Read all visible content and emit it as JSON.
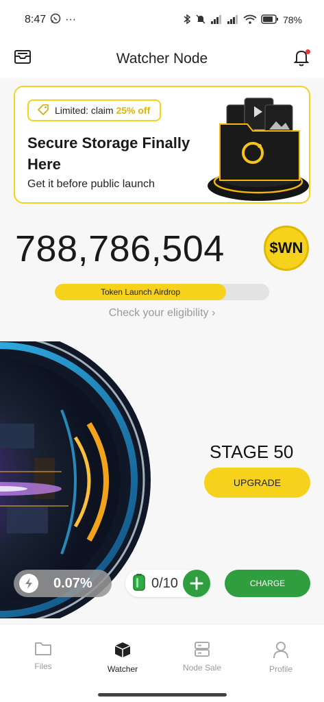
{
  "status_bar": {
    "time": "8:47",
    "dots": "···",
    "battery": "78%"
  },
  "header": {
    "title": "Watcher Node"
  },
  "promo": {
    "badge_prefix": "Limited: claim ",
    "badge_highlight": "25% off",
    "title": "Secure Storage Finally Here",
    "subtitle": "Get it before public launch"
  },
  "balance": {
    "amount": "788,786,504",
    "token": "$WN"
  },
  "airdrop": {
    "label": "Token Launch Airdrop",
    "progress": 0.8,
    "eligibility": "Check your eligibility ›"
  },
  "node": {
    "stage": "STAGE 50",
    "upgrade_label": "UPGRADE"
  },
  "stats": {
    "percentage": "0.07%",
    "battery_count": "0/10",
    "charge_label": "CHARGE"
  },
  "tabs": [
    {
      "label": "Files",
      "icon": "folder-icon"
    },
    {
      "label": "Watcher",
      "icon": "cube-icon"
    },
    {
      "label": "Node Sale",
      "icon": "server-icon"
    },
    {
      "label": "Profile",
      "icon": "user-icon"
    }
  ],
  "colors": {
    "accent_yellow": "#f7d21c",
    "accent_green": "#2e9e3e"
  }
}
